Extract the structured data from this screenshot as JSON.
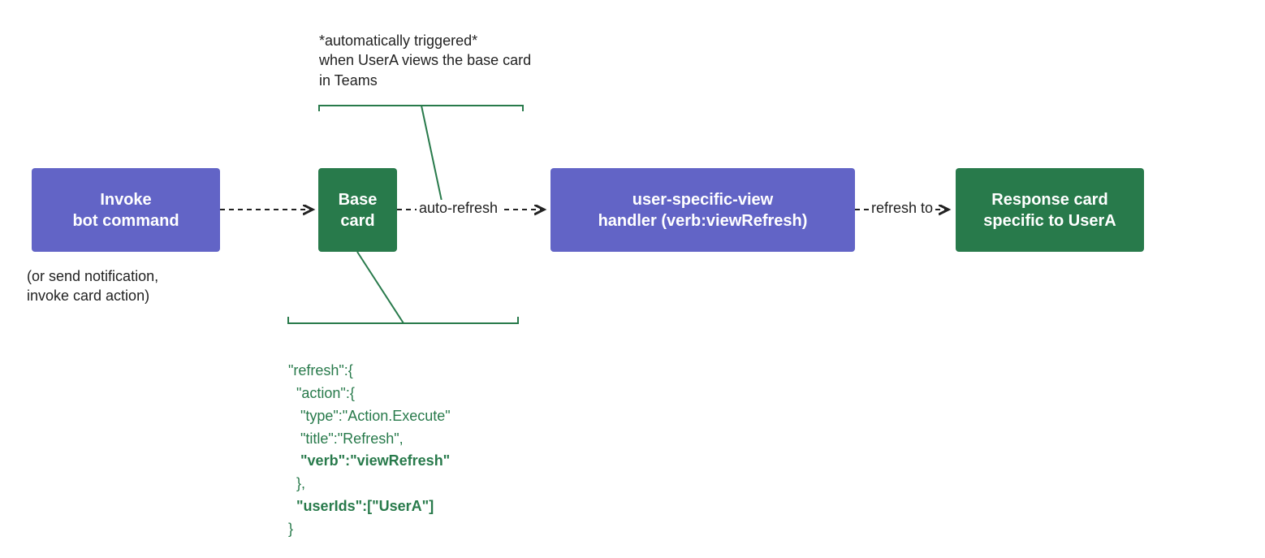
{
  "colors": {
    "purple": "#6264c6",
    "green": "#287a4b"
  },
  "boxes": {
    "invoke": {
      "line1": "Invoke",
      "line2": "bot command"
    },
    "base": {
      "line1": "Base",
      "line2": "card"
    },
    "handler": {
      "line1": "user-specific-view",
      "line2": "handler (verb:viewRefresh)"
    },
    "response": {
      "line1": "Response card",
      "line2": "specific to UserA"
    }
  },
  "captions": {
    "top": {
      "line1": "*automatically triggered*",
      "line2": "when UserA views the base card",
      "line3": "in Teams"
    },
    "invoke_sub": {
      "line1": "(or send notification,",
      "line2": "invoke card action)"
    }
  },
  "arrows": {
    "auto_refresh": "auto-refresh",
    "refresh_to": "refresh to"
  },
  "code": {
    "l1": "\"refresh\":{",
    "l2": "  \"action\":{",
    "l3": "   \"type\":\"Action.Execute\"",
    "l4": "   \"title\":\"Refresh\",",
    "l5a": "   ",
    "l5b": "\"verb\":\"viewRefresh\"",
    "l6": "  },",
    "l7a": "  ",
    "l7b": "\"userIds\":[\"UserA\"]",
    "l8": "}"
  }
}
